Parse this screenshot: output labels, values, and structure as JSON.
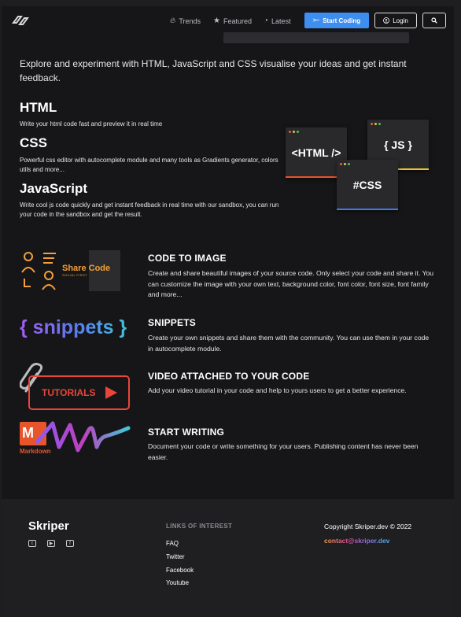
{
  "nav": {
    "links": [
      {
        "label": "Trends",
        "icon": "fire-icon"
      },
      {
        "label": "Featured",
        "icon": "star-icon"
      },
      {
        "label": "Latest",
        "icon": "clock-icon"
      }
    ],
    "start_label": "Start Coding",
    "login_label": "Login"
  },
  "intro": "Explore and experiment with HTML, JavaScript and CSS visualise your ideas and get instant feedback.",
  "languages": [
    {
      "title": "HTML",
      "desc": "Write your html code fast and preview it in real time"
    },
    {
      "title": "CSS",
      "desc": "Powerful css editor with autocomplete module and many tools as Gradients generator, colors utils and more..."
    },
    {
      "title": "JavaScript",
      "desc": "Write cool js code quickly and get instant feedback in real time with our sandbox, you can run your code in the sandbox and get the result."
    }
  ],
  "cards": {
    "html": "<HTML />",
    "js": "{ JS }",
    "css": "#CSS"
  },
  "features": [
    {
      "title": "CODE TO IMAGE",
      "desc": "Create and share beautiful images of your source code. Only select your code and share it. You can customize the image with your own text, background color, font color, font size, font family and more..."
    },
    {
      "title": "SNIPPETS",
      "desc": "Create your own snippets and share them with the community. You can use them in your code in autocomplete module."
    },
    {
      "title": "VIDEO ATTACHED TO YOUR CODE",
      "desc": "Add your video tutorial in your code and help to yours users to get a better experience."
    },
    {
      "title": "START WRITING",
      "desc": "Document your code or write something for your users. Publishing content has never been easier."
    }
  ],
  "feature_images": {
    "share_code": "Share Code",
    "share_code_sub": "SOCIAL FIRST",
    "snippets": "{ snippets }",
    "tutorials": "TUTORIALS",
    "markdown": "Markdown"
  },
  "footer": {
    "brand": "Skriper",
    "links_heading": "LINKS OF INTEREST",
    "links": [
      "FAQ",
      "Twitter",
      "Facebook",
      "Youtube"
    ],
    "copyright": "Copyright Skriper.dev © 2022",
    "email": "contact@skriper.dev"
  },
  "colors": {
    "accent": "#3e8ef0",
    "background": "#161618",
    "html_bar": "#e8542a",
    "js_bar": "#e8c532",
    "css_bar": "#3a7de6"
  }
}
